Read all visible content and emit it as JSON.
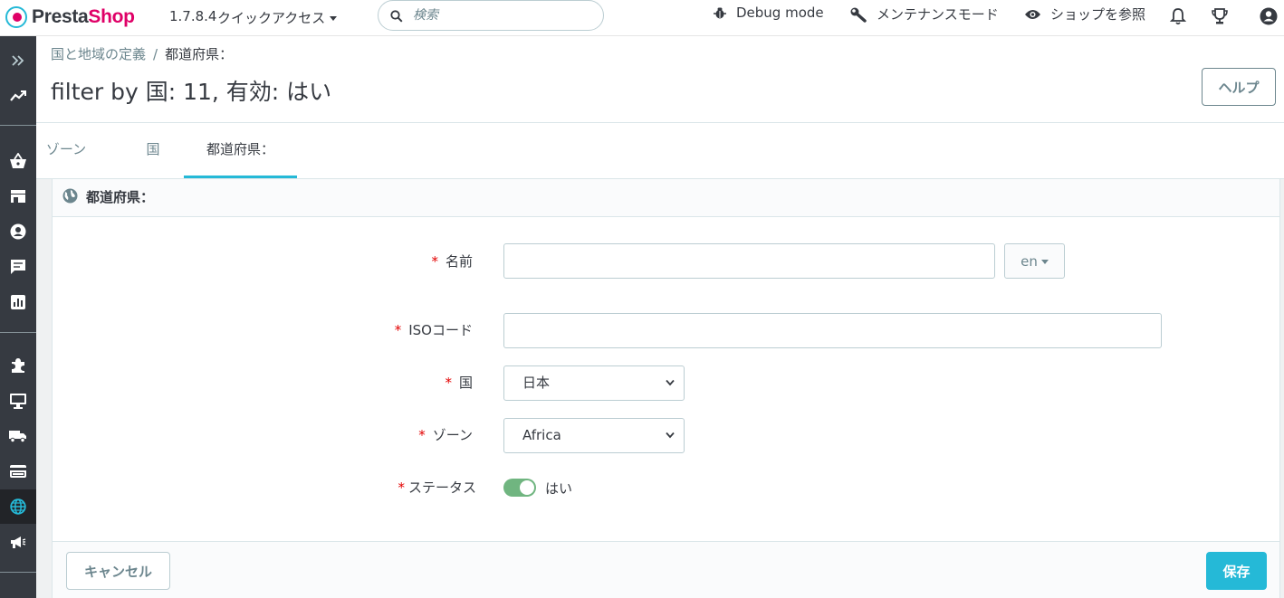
{
  "header": {
    "logo_prefix": "Presta",
    "logo_suffix": "Shop",
    "version": "1.7.8.4",
    "quick_access": "クイックアクセス",
    "search_placeholder": "検索",
    "debug_mode": "Debug mode",
    "maintenance": "メンテナンスモード",
    "view_shop": "ショップを参照"
  },
  "sidebar": {
    "items": [
      "expand-icon",
      "dashboard-icon",
      "orders-icon",
      "catalog-icon",
      "customers-icon",
      "messages-icon",
      "stats-icon",
      "modules-icon",
      "design-icon",
      "shipping-icon",
      "payment-icon",
      "international-icon",
      "marketing-icon"
    ],
    "active": "international-icon"
  },
  "breadcrumb": {
    "parent": "国と地域の定義",
    "separator": "/",
    "current": "都道府県："
  },
  "page_title": "filter by 国: 11, 有効: はい",
  "help_label": "ヘルプ",
  "tabs": [
    {
      "label": "ゾーン",
      "active": false
    },
    {
      "label": "国",
      "active": false
    },
    {
      "label": "都道府県：",
      "active": true
    }
  ],
  "panel": {
    "title": "都道府県：",
    "fields": {
      "name": {
        "required": "*",
        "label": "名前",
        "value": "",
        "lang": "en"
      },
      "iso": {
        "required": "*",
        "label": "ISOコード",
        "value": ""
      },
      "country": {
        "required": "*",
        "label": "国",
        "selected": "日本"
      },
      "zone": {
        "required": "*",
        "label": "ゾーン",
        "selected": "Africa"
      },
      "status": {
        "required": "*",
        "label": "ステータス",
        "value": "はい",
        "on": true
      }
    },
    "cancel_label": "キャンセル",
    "save_label": "保存"
  },
  "colors": {
    "accent": "#25b9d7",
    "brand_pink": "#df0067",
    "sidebar": "#363a41",
    "switch_on": "#70b580",
    "required": "#e30000"
  }
}
